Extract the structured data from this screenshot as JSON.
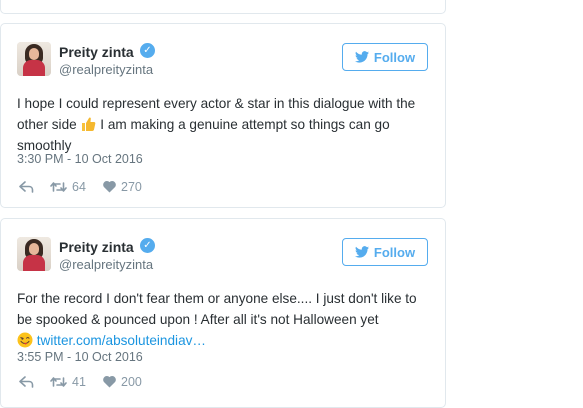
{
  "colors": {
    "accent": "#55acee",
    "link": "#1b95e0",
    "muted": "#66757f",
    "border": "#e1e8ed"
  },
  "tweets": [
    {
      "author_name": "Preity zinta",
      "author_handle": "@realpreityzinta",
      "verified": true,
      "follow_label": "Follow",
      "text_part1": "I hope I could represent every actor & star in this dialogue with the other side ",
      "emoji": "thumbs-up-emoji",
      "text_part2": " I am making a genuine attempt so things can go smoothly",
      "timestamp": "3:30 PM - 10 Oct 2016",
      "retweets": "64",
      "likes": "270"
    },
    {
      "author_name": "Preity zinta",
      "author_handle": "@realpreityzinta",
      "verified": true,
      "follow_label": "Follow",
      "text_part1": "For the record I don't fear them or anyone else.... I just don't like to be spooked & pounced upon ! After all it's not Halloween yet",
      "emoji": "winking-tongue-emoji",
      "link_text": "twitter.com/absoluteindiav…",
      "timestamp": "3:55 PM - 10 Oct 2016",
      "retweets": "41",
      "likes": "200"
    }
  ]
}
